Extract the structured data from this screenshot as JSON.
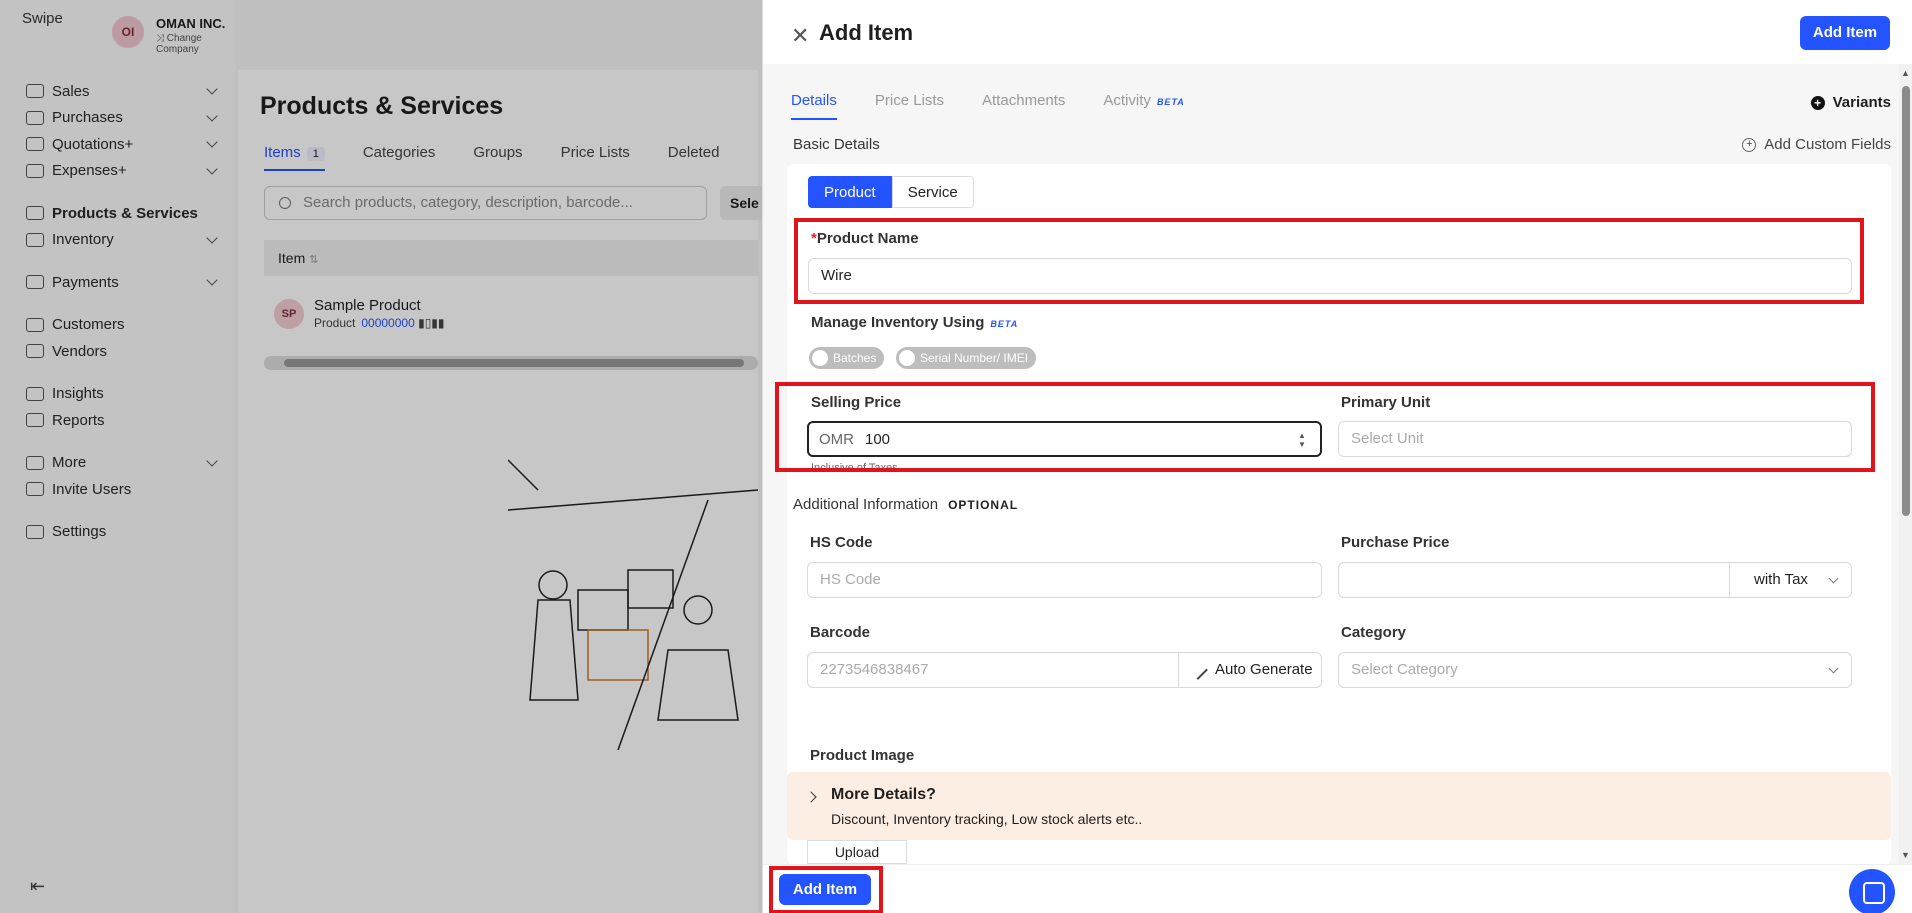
{
  "brand": {
    "logo_alt": "Swipe",
    "company_initials": "OI",
    "company_name": "OMAN INC.",
    "change_company": "Change Company"
  },
  "sidebar": {
    "groups": [
      [
        {
          "label": "Sales",
          "icon": "money-icon",
          "chevron": true
        },
        {
          "label": "Purchases",
          "icon": "cart-icon",
          "chevron": true
        },
        {
          "label": "Quotations+",
          "icon": "pen-icon",
          "chevron": true
        },
        {
          "label": "Expenses+",
          "icon": "tag-icon",
          "chevron": true
        }
      ],
      [
        {
          "label": "Products & Services",
          "icon": "barcode-icon",
          "chevron": false,
          "active": true
        },
        {
          "label": "Inventory",
          "icon": "warehouse-icon",
          "chevron": true
        }
      ],
      [
        {
          "label": "Payments",
          "icon": "payment-icon",
          "chevron": true
        }
      ],
      [
        {
          "label": "Customers",
          "icon": "user-icon",
          "chevron": false
        },
        {
          "label": "Vendors",
          "icon": "vendor-icon",
          "chevron": false
        }
      ],
      [
        {
          "label": "Insights",
          "icon": "chart-icon",
          "chevron": false
        },
        {
          "label": "Reports",
          "icon": "report-icon",
          "chevron": false
        }
      ],
      [
        {
          "label": "More",
          "icon": "more-icon",
          "chevron": true
        },
        {
          "label": "Invite Users",
          "icon": "add-user-icon",
          "chevron": false
        }
      ],
      [
        {
          "label": "Settings",
          "icon": "gear-icon",
          "chevron": false
        }
      ]
    ]
  },
  "products_page": {
    "title": "Products & Services",
    "tabs": [
      "Items",
      "Categories",
      "Groups",
      "Price Lists",
      "Deleted"
    ],
    "items_count": "1",
    "search_placeholder": "Search products, category, description, barcode...",
    "select_label": "Sele",
    "column_item": "Item",
    "row": {
      "initials": "SP",
      "name": "Sample Product",
      "type": "Product",
      "code": "00000000"
    }
  },
  "drawer": {
    "title": "Add Item",
    "add_item_label": "Add Item",
    "tabs": [
      {
        "label": "Details",
        "beta": false
      },
      {
        "label": "Price Lists",
        "beta": false
      },
      {
        "label": "Attachments",
        "beta": false
      },
      {
        "label": "Activity",
        "beta": true
      }
    ],
    "beta_label": "BETA",
    "variants_label": "Variants",
    "basic_details_label": "Basic Details",
    "add_custom_fields_label": "Add Custom Fields",
    "type_options": [
      "Product",
      "Service"
    ],
    "product_name": {
      "label": "Product Name",
      "value": "Wire"
    },
    "manage_inventory": {
      "label": "Manage Inventory Using",
      "options": [
        "Batches",
        "Serial Number/ IMEI"
      ]
    },
    "selling_price": {
      "label": "Selling Price",
      "currency": "OMR",
      "value": "100",
      "hint": "Inclusive of Taxes"
    },
    "primary_unit": {
      "label": "Primary Unit",
      "placeholder": "Select Unit"
    },
    "additional_info": {
      "label": "Additional Information",
      "tag": "OPTIONAL"
    },
    "hs_code": {
      "label": "HS Code",
      "placeholder": "HS Code"
    },
    "purchase_price": {
      "label": "Purchase Price",
      "tax_option": "with Tax"
    },
    "barcode": {
      "label": "Barcode",
      "placeholder": "2273546838467",
      "auto_generate": "Auto Generate"
    },
    "category": {
      "label": "Category",
      "placeholder": "Select Category"
    },
    "product_image": {
      "label": "Product Image",
      "upload": "Upload"
    },
    "more_details": {
      "title": "More Details?",
      "subtitle": "Discount, Inventory tracking, Low stock alerts etc.."
    }
  },
  "colors": {
    "primary": "#2454ff",
    "highlight": "#e0141a",
    "more_details_bg": "#fdeee3"
  }
}
